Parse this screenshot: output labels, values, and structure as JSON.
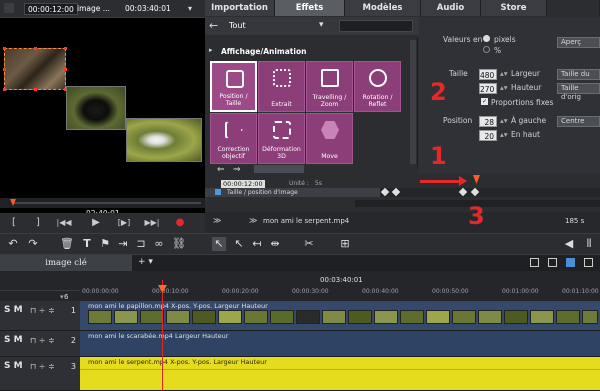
{
  "preview": {
    "timecode_current": "00:00:12:00",
    "clip_name": "image ...",
    "timecode_total": "00:03:40:01",
    "scrub_timecode": "02:40:01",
    "transport": [
      "[",
      "]",
      "|◀◀",
      "▶",
      "[▶]",
      "▶▶|",
      "●"
    ]
  },
  "tabs": [
    {
      "label": "Importation",
      "active": false
    },
    {
      "label": "Effets",
      "active": true
    },
    {
      "label": "Modèles",
      "active": false
    },
    {
      "label": "Audio",
      "active": false
    },
    {
      "label": "Store",
      "active": false
    }
  ],
  "category": {
    "selected": "Tout",
    "back_icon": "arrow-left-icon"
  },
  "section_header": "Affichage/Animation",
  "effects": [
    {
      "label": "Position / Taille",
      "icon": "position-size-icon",
      "selected": true
    },
    {
      "label": "Extrait",
      "icon": "crop-icon",
      "selected": false
    },
    {
      "label": "Travelling / Zoom",
      "icon": "camera-zoom-icon",
      "selected": false
    },
    {
      "label": "Rotation / Reflet",
      "icon": "rotate-icon",
      "selected": false
    },
    {
      "label": "Correction objectif",
      "icon": "lens-icon",
      "selected": false
    },
    {
      "label": "Déformation 3D",
      "icon": "3d-deform-icon",
      "selected": false
    },
    {
      "label": "Move",
      "icon": "move-hex-icon",
      "selected": false
    }
  ],
  "properties": {
    "values_in_label": "Valeurs en",
    "unit_pixels": "pixels",
    "unit_percent": "%",
    "preview_button": "Aperç",
    "size_label": "Taille",
    "width_value": "480",
    "width_label": "Largeur",
    "width_button": "Taille du",
    "height_value": "270",
    "height_label": "Hauteur",
    "height_button": "Taille d'orig",
    "proportions_label": "Proportions fixes",
    "position_label": "Position",
    "left_value": "28",
    "left_label": "À gauche",
    "left_button": "Centre",
    "top_value": "20",
    "top_label": "En haut"
  },
  "keyframes": {
    "timecode": "00:00:12:00",
    "unit_label": "Unité :",
    "unit_value": "5s",
    "track_label": "Taille / position d'image",
    "clip_name": "mon ami le serpent.mp4",
    "duration": "185 s"
  },
  "annotations": [
    "1",
    "2",
    "3"
  ],
  "toolbar": {
    "icons": [
      "undo-icon",
      "redo-icon",
      "delete-icon",
      "text-icon",
      "flag-icon",
      "split-icon",
      "group-icon",
      "link-icon",
      "unlink-icon",
      "pointer-icon",
      "pointer-range-icon",
      "pointer-single-icon",
      "pointer-move-icon",
      "cut-icon",
      "insert-icon",
      "volume-icon",
      "mixer-icon"
    ]
  },
  "timeline": {
    "tab_label": "image clé",
    "add_label": "+ ▾",
    "ruler_time": "00:03:40:01",
    "ruler_ticks": [
      "00:00:00:00",
      "00:00:10:00",
      "00:00:20:00",
      "00:00:30:00",
      "00:00:40:00",
      "00:00:50:00",
      "00:01:00:00",
      "00:01:10:00"
    ],
    "track_count": "6",
    "tracks": [
      {
        "number": "1",
        "smn": "S M",
        "label": "mon ami le papillon.mp4   X-pos.  Y-pos.  Largeur  Hauteur"
      },
      {
        "number": "2",
        "smn": "S M",
        "label": "mon ami le scarabée.mp4   Largeur  Hauteur"
      },
      {
        "number": "3",
        "smn": "S M",
        "label": "mon ami le serpent.mp4   X-pos.  Y-pos.  Largeur  Hauteur"
      }
    ]
  },
  "colors": {
    "accent_magenta": "#8c3e78",
    "clip_blue": "#354a6b",
    "clip_yellow": "#e4dc1c",
    "annotation_red": "#e82828"
  }
}
